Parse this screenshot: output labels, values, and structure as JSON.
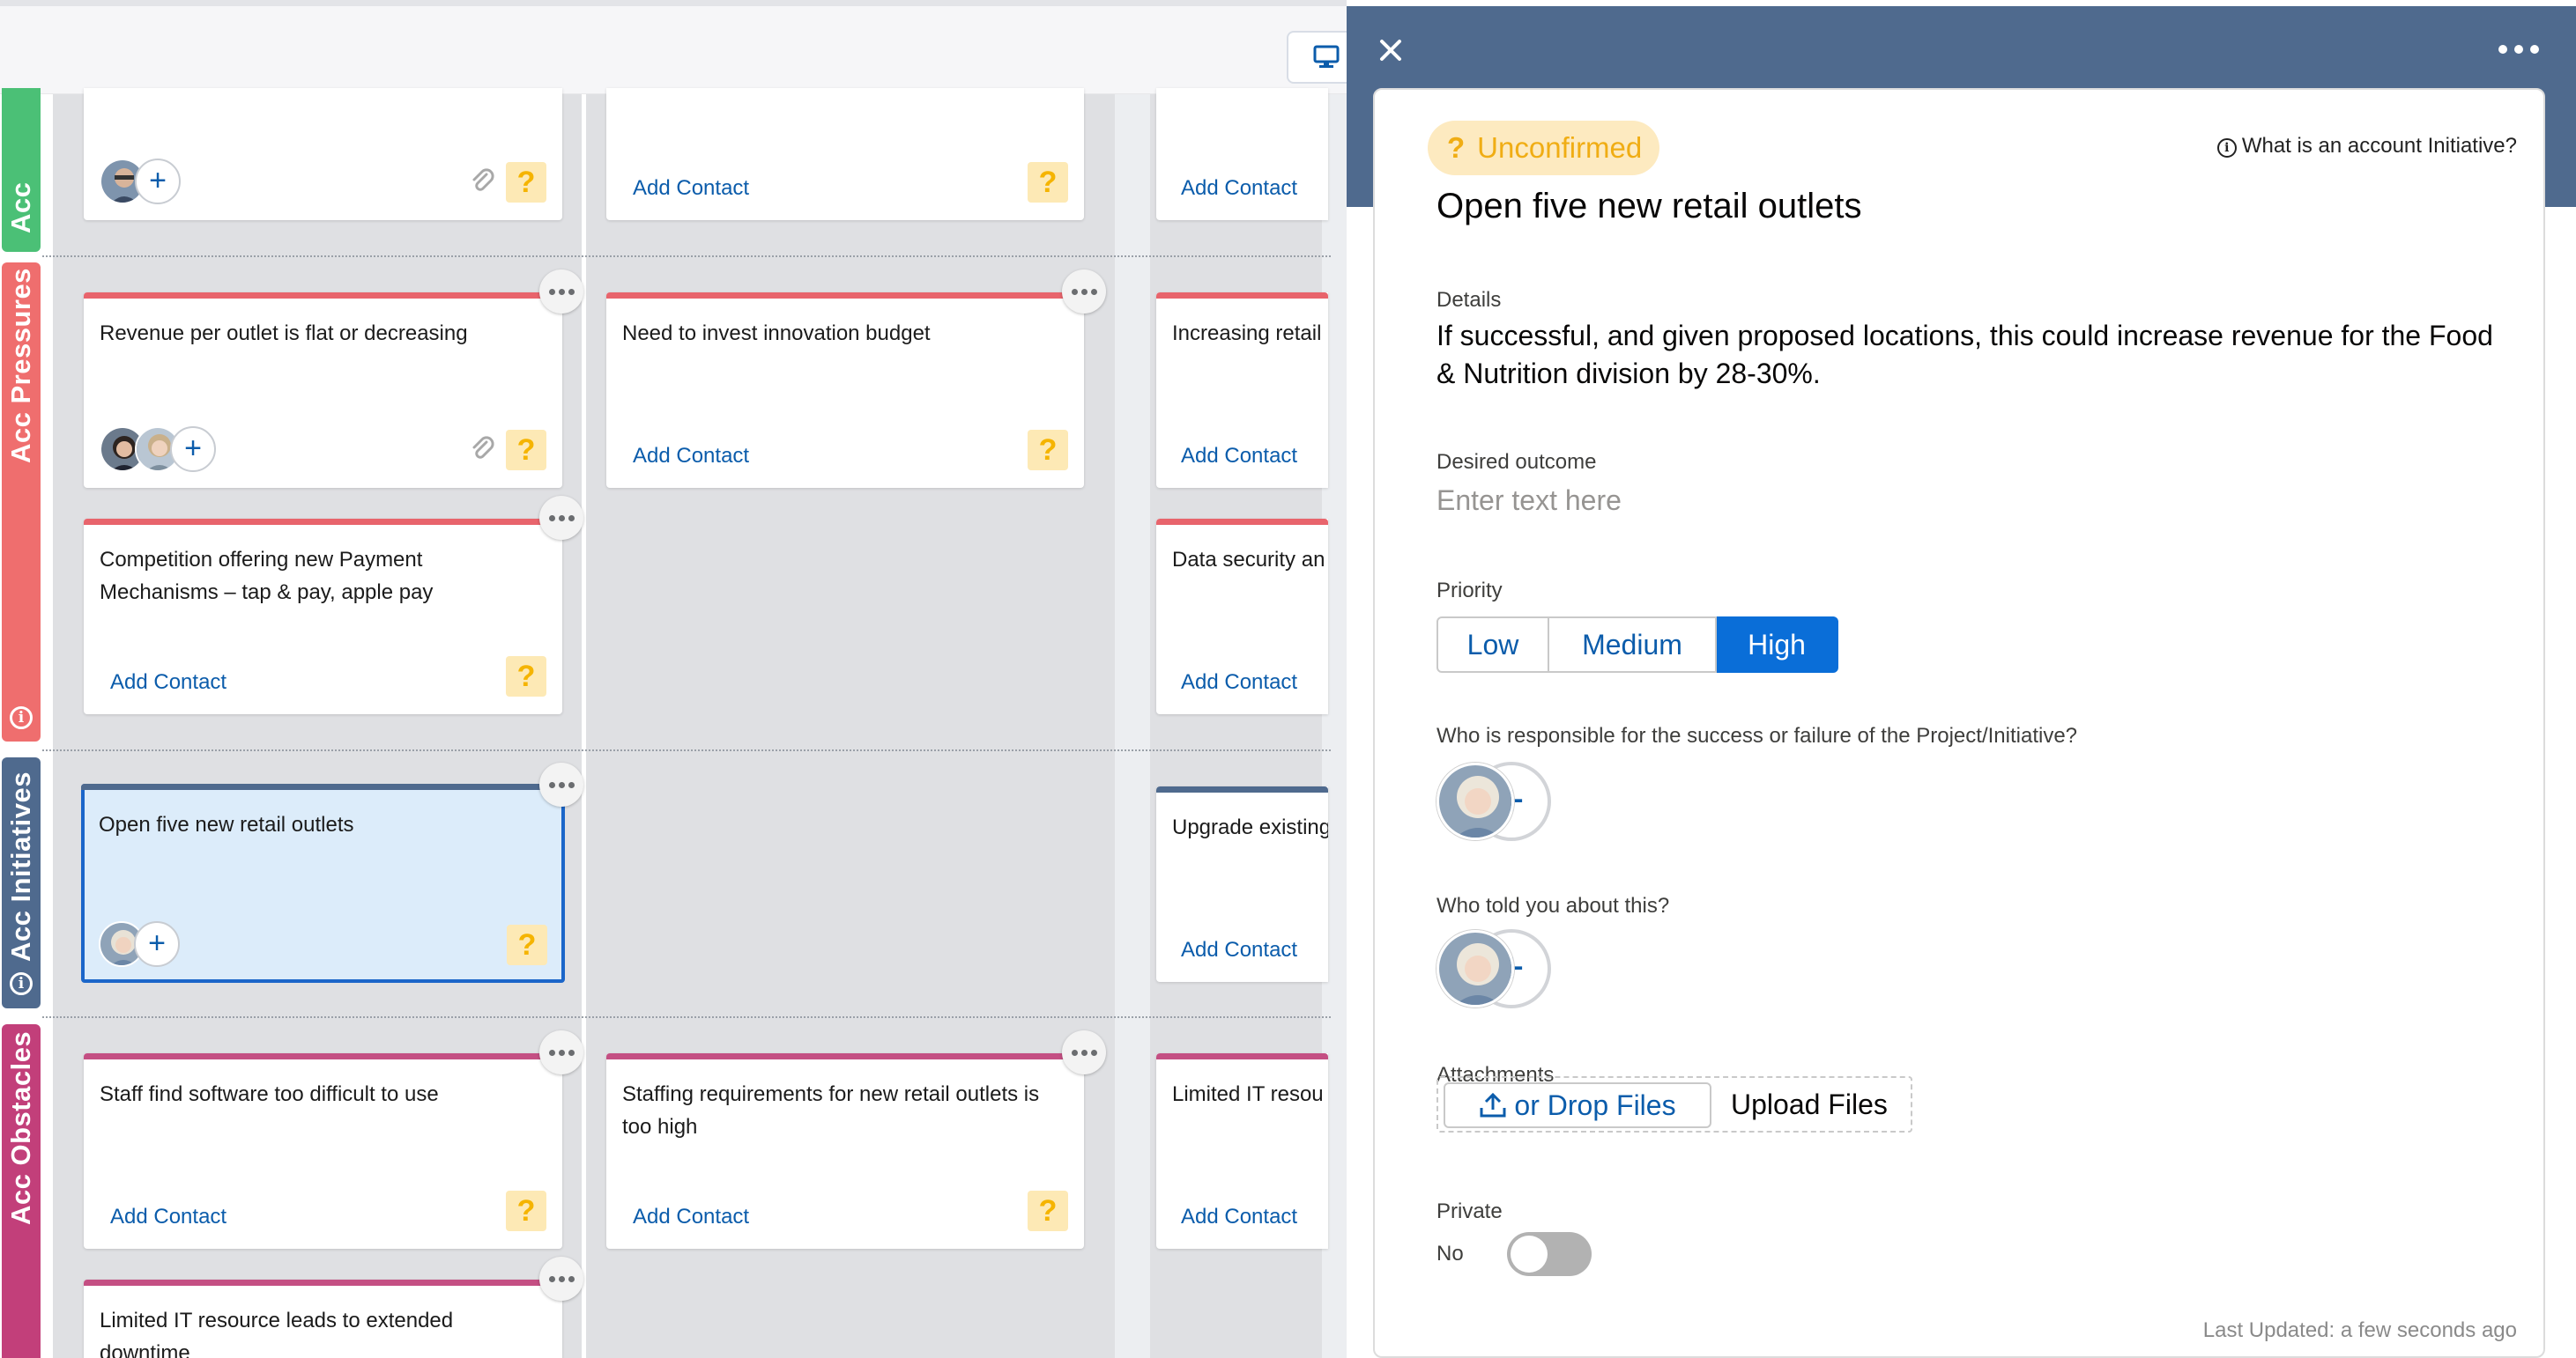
{
  "lanes": [
    {
      "label": "Acc",
      "color": "#4bc076"
    },
    {
      "label": "Acc Pressures",
      "color": "#ef6e6e"
    },
    {
      "label": "Acc Initiatives",
      "color": "#4f6a8e"
    },
    {
      "label": "Acc Obstacles",
      "color": "#c23f7a"
    }
  ],
  "cards": {
    "r0c1": {
      "add_contact": "Add Contact"
    },
    "r0c2": {
      "add_contact": "Add Contact"
    },
    "r1c0": {
      "title": "Revenue per outlet is flat or decreasing"
    },
    "r1c1": {
      "title": "Need to invest innovation budget",
      "add_contact": "Add Contact"
    },
    "r1c2": {
      "title": "Increasing retail",
      "add_contact": "Add Contact"
    },
    "r2c0": {
      "title": "Competition offering new Payment Mechanisms – tap & pay, apple pay",
      "add_contact": "Add Contact"
    },
    "r2c2": {
      "title": "Data security an",
      "add_contact": "Add Contact"
    },
    "r3c0": {
      "title": "Open five new retail outlets"
    },
    "r3c2": {
      "title": "Upgrade existing",
      "add_contact": "Add Contact"
    },
    "r4c0": {
      "title": "Staff find software too difficult to use",
      "add_contact": "Add Contact"
    },
    "r4c1": {
      "title": "Staffing requirements for new retail outlets is too high",
      "add_contact": "Add Contact"
    },
    "r4c2": {
      "title": "Limited IT resou",
      "add_contact": "Add Contact"
    },
    "r5c0": {
      "title": "Limited IT resource leads to extended downtime"
    }
  },
  "card_status_symbol": "?",
  "panel": {
    "status": "Unconfirmed",
    "status_symbol": "?",
    "help_link": "What is an account Initiative?",
    "title": "Open five new retail outlets",
    "details_label": "Details",
    "details_value": "If successful, and given proposed locations, this could increase revenue for the Food & Nutrition division by 28-30%.",
    "desired_outcome_label": "Desired outcome",
    "desired_outcome_placeholder": "Enter text here",
    "priority_label": "Priority",
    "priority_options": [
      "Low",
      "Medium",
      "High"
    ],
    "priority_selected": "High",
    "responsible_label": "Who is responsible for the success or failure of the Project/Initiative?",
    "told_label": "Who told you about this?",
    "attachments_label": "Attachments",
    "upload_button": "or Drop Files",
    "upload_text": "Upload Files",
    "private_label": "Private",
    "private_value": "No",
    "last_updated": "Last Updated: a few seconds ago"
  },
  "icons": [
    "close-icon",
    "more-icon",
    "desktop-icon",
    "info-icon",
    "paperclip-icon",
    "upload-icon",
    "question-icon",
    "plus-icon"
  ],
  "colors": {
    "accent": "#0a6ed8",
    "panel_header": "#4f6a8e",
    "pressure": "#ef6e6e",
    "obstacle": "#c23f7a",
    "status_yellow": "#f0ad14"
  }
}
